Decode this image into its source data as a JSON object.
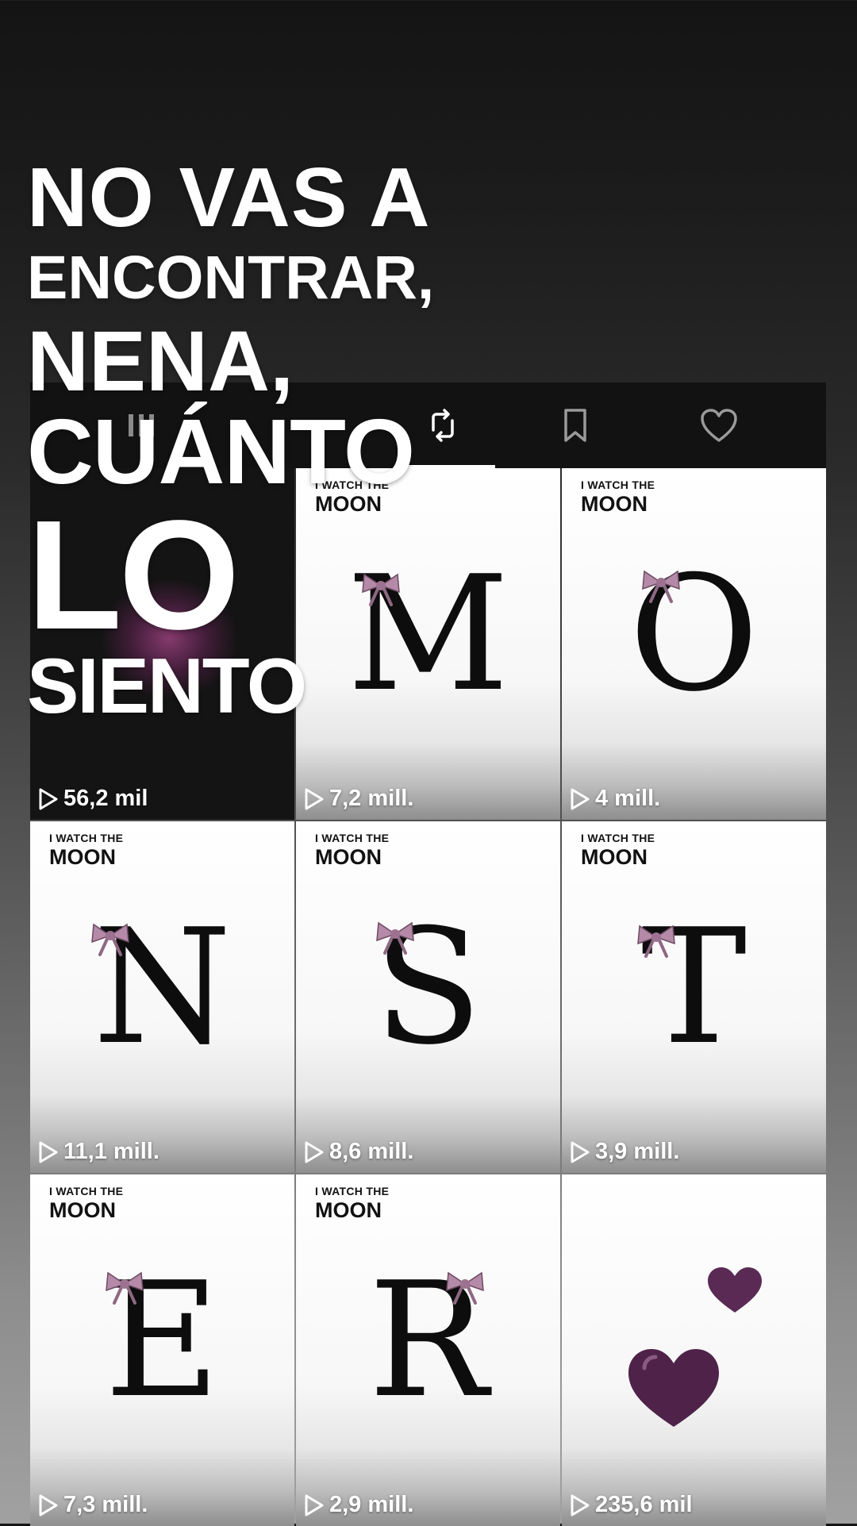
{
  "caption": {
    "lines": [
      "NO VAS A",
      "ENCONTRAR,",
      "NENA,",
      "CUÁNTO",
      "LO",
      "SIENTO"
    ]
  },
  "tabs": [
    {
      "icon": "grid-icon"
    },
    {
      "icon": "repost-icon"
    },
    {
      "icon": "bookmark-icon"
    },
    {
      "icon": "heart-icon"
    }
  ],
  "videos": [
    {
      "brand_top": "",
      "brand_bottom": "",
      "letter": "",
      "views": "56,2 mil"
    },
    {
      "brand_top": "I WATCH THE",
      "brand_bottom": "MOON",
      "letter": "M",
      "views": "7,2 mill."
    },
    {
      "brand_top": "I WATCH THE",
      "brand_bottom": "MOON",
      "letter": "O",
      "views": "4 mill."
    },
    {
      "brand_top": "I WATCH THE",
      "brand_bottom": "MOON",
      "letter": "N",
      "views": "11,1 mill."
    },
    {
      "brand_top": "I WATCH THE",
      "brand_bottom": "MOON",
      "letter": "S",
      "views": "8,6 mill."
    },
    {
      "brand_top": "I WATCH THE",
      "brand_bottom": "MOON",
      "letter": "T",
      "views": "3,9 mill."
    },
    {
      "brand_top": "I WATCH THE",
      "brand_bottom": "MOON",
      "letter": "E",
      "views": "7,3 mill."
    },
    {
      "brand_top": "I WATCH THE",
      "brand_bottom": "MOON",
      "letter": "R",
      "views": "2,9 mill."
    },
    {
      "brand_top": "",
      "brand_bottom": "",
      "letter": "",
      "icon": "purple-hearts-icon",
      "views": "235,6 mil"
    }
  ],
  "colors": {
    "heart_purple": "#5a2a55",
    "bow_pink": "#b58aa8",
    "tab_strip": "#121212"
  }
}
